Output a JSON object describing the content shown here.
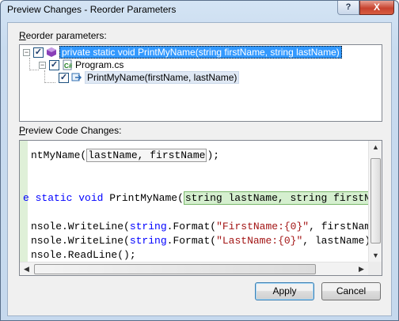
{
  "window": {
    "title": "Preview Changes - Reorder Parameters",
    "help_glyph": "?",
    "close_glyph": "X"
  },
  "reorder": {
    "label_prefix": "",
    "label_accel": "R",
    "label_rest": "eorder parameters:",
    "items": [
      {
        "label": "private static void PrintMyName(string firstName, string lastName)",
        "checked": true,
        "expanded": true,
        "icon": "method-icon"
      },
      {
        "label": "Program.cs",
        "checked": true,
        "expanded": true,
        "icon": "csharp-file-icon"
      },
      {
        "label": "PrintMyName(firstName, lastName)",
        "checked": true,
        "icon": "reference-icon"
      }
    ]
  },
  "preview": {
    "label_accel": "P",
    "label_rest": "review Code Changes:",
    "lines": [
      {
        "parts": [
          {
            "t": "ntMyName("
          },
          {
            "t": "lastName, firstName",
            "c": "box1"
          },
          {
            "t": ");"
          }
        ]
      },
      {
        "parts": [
          {
            "t": ""
          }
        ]
      },
      {
        "parts": [
          {
            "t": "e ",
            "c": "kw"
          },
          {
            "t": "static",
            "c": "kw"
          },
          {
            "t": " "
          },
          {
            "t": "void",
            "c": "kw"
          },
          {
            "t": " PrintMyName("
          },
          {
            "t": "string lastName, string firstName",
            "c": "box2"
          },
          {
            "t": ")"
          }
        ]
      },
      {
        "parts": [
          {
            "t": ""
          }
        ]
      },
      {
        "parts": [
          {
            "t": "nsole.WriteLine("
          },
          {
            "t": "string",
            "c": "kw"
          },
          {
            "t": ".Format("
          },
          {
            "t": "\"FirstName:{0}\"",
            "c": "str"
          },
          {
            "t": ", firstName));"
          }
        ]
      },
      {
        "parts": [
          {
            "t": "nsole.WriteLine("
          },
          {
            "t": "string",
            "c": "kw"
          },
          {
            "t": ".Format("
          },
          {
            "t": "\"LastName:{0}\"",
            "c": "str"
          },
          {
            "t": ", lastName));"
          }
        ]
      },
      {
        "parts": [
          {
            "t": "nsole.ReadLine();"
          }
        ]
      }
    ]
  },
  "buttons": {
    "apply": "Apply",
    "cancel": "Cancel"
  }
}
